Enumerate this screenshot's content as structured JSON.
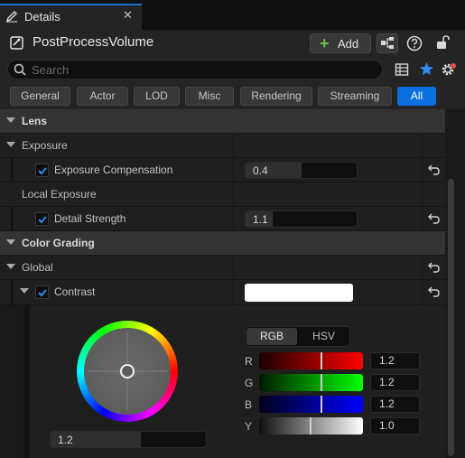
{
  "tab": {
    "title": "Details",
    "close_glyph": "✕",
    "icon": "pencil-icon"
  },
  "header": {
    "actor_name": "PostProcessVolume",
    "add_label": "Add",
    "add_plus": "+"
  },
  "search": {
    "placeholder": "Search"
  },
  "filters": [
    "General",
    "Actor",
    "LOD",
    "Misc",
    "Rendering",
    "Streaming",
    "All"
  ],
  "active_filter": "All",
  "properties": {
    "lens": "Lens",
    "exposure": "Exposure",
    "exposure_comp": {
      "label": "Exposure Compensation",
      "value": "0.4",
      "fill": 0.5,
      "checked": true
    },
    "local_exposure": "Local Exposure",
    "detail_strength": {
      "label": "Detail Strength",
      "value": "1.1",
      "fill": 0.24,
      "checked": true
    },
    "color_grading": "Color Grading",
    "global": "Global",
    "contrast": {
      "label": "Contrast",
      "checked": true,
      "swatch": "#ffffff"
    }
  },
  "color_picker": {
    "wheel_value": "1.2",
    "modes": {
      "rgb": "RGB",
      "hsv": "HSV",
      "active": "RGB"
    },
    "channels": {
      "r": {
        "label": "R",
        "value": "1.2",
        "marker": 0.59
      },
      "g": {
        "label": "G",
        "value": "1.2",
        "marker": 0.59
      },
      "b": {
        "label": "B",
        "value": "1.2",
        "marker": 0.59
      },
      "y": {
        "label": "Y",
        "value": "1.0",
        "marker": 0.49
      }
    }
  },
  "colors": {
    "accent": "#0a70e0",
    "add_green": "#6ec24a",
    "star": "#2f8cf0"
  }
}
